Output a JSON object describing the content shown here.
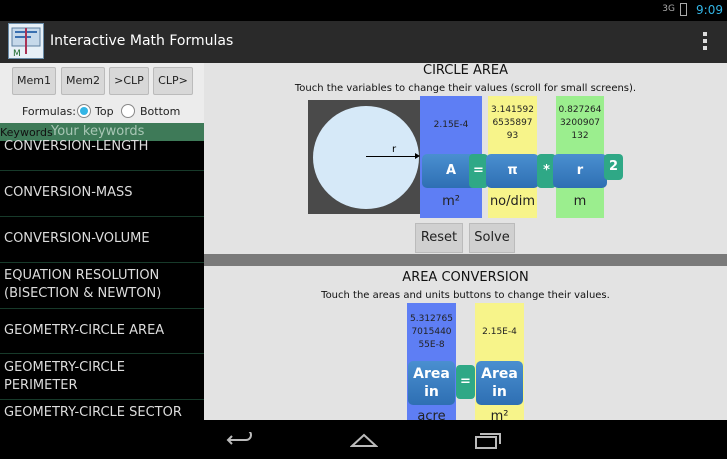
{
  "status": {
    "signal": "3G",
    "time": "9:09"
  },
  "app": {
    "title": "Interactive Math Formulas",
    "logo_text": "M"
  },
  "left": {
    "memory_buttons": [
      "Mem1",
      "Mem2",
      ">CLP",
      "CLP>"
    ],
    "formulas_label": "Formulas:",
    "radio_top": "Top",
    "radio_bottom": "Bottom",
    "keywords_label": "Keywords",
    "keywords_placeholder": "Your keywords",
    "list": [
      "CONVERSION-LENGTH",
      "CONVERSION-MASS",
      "CONVERSION-VOLUME",
      "EQUATION RESOLUTION (BISECTION & NEWTON)",
      "GEOMETRY-CIRCLE AREA",
      "GEOMETRY-CIRCLE PERIMETER",
      "GEOMETRY-CIRCLE SECTOR"
    ]
  },
  "circle_area": {
    "title": "CIRCLE AREA",
    "subtitle": "Touch the variables to change their values (scroll for small screens).",
    "radius_label": "r",
    "vars": [
      {
        "value": "2.15E-4",
        "label": "A",
        "unit": "m²",
        "color": "#5e7ef4"
      },
      {
        "value": "3.141592\n6535897\n93",
        "label": "π",
        "unit": "no/dim",
        "color": "#f7f48a"
      },
      {
        "value": "0.827264\n3200907\n132",
        "label": "r",
        "unit": "m",
        "color": "#9bee8e"
      }
    ],
    "ops": [
      "=",
      "*",
      "2"
    ],
    "reset_label": "Reset",
    "solve_label": "Solve"
  },
  "area_conversion": {
    "title": "AREA CONVERSION",
    "subtitle": "Touch the areas and units buttons to change their values.",
    "left_value": "5.312765\n7015440\n55E-8",
    "right_value": "2.15E-4",
    "left_label": "Area\nin",
    "right_label": "Area\nin",
    "op": "=",
    "left_unit": "acre",
    "right_unit": "m²"
  },
  "nav": {
    "back": "back-icon",
    "home": "home-icon",
    "recents": "recents-icon"
  }
}
